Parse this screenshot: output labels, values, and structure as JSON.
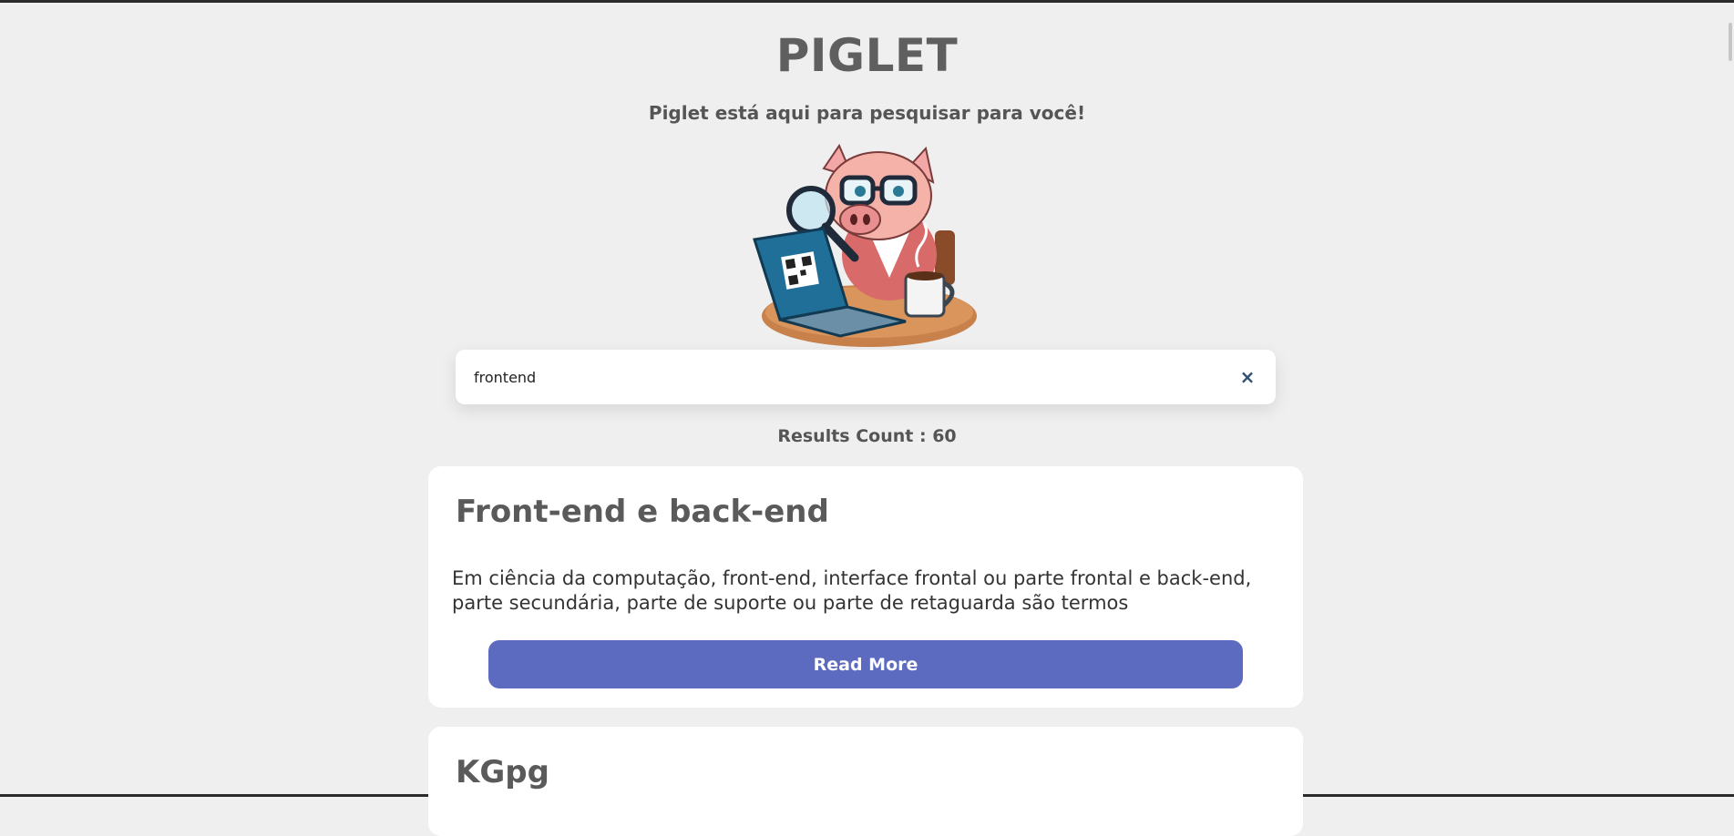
{
  "header": {
    "title": "PIGLET",
    "subtitle": "Piglet está aqui para pesquisar para você!"
  },
  "mascot": {
    "icon": "pig-detective-laptop-icon"
  },
  "search": {
    "value": "frontend",
    "clear_icon": "close-icon",
    "clear_label": "×"
  },
  "results": {
    "count_text": "Results Count : 60",
    "items": [
      {
        "title": "Front-end e back-end",
        "snippet": "Em ciência da computação, front-end, interface frontal ou parte frontal e back-end, parte secundária, parte de suporte ou parte de retaguarda são termos",
        "button_label": "Read More"
      },
      {
        "title": "KGpg"
      }
    ]
  },
  "colors": {
    "background": "#efefef",
    "accent_button": "#5c6bc0",
    "card_background": "#ffffff"
  }
}
